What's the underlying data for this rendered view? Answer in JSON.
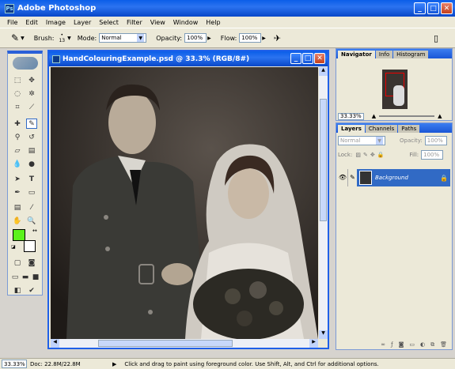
{
  "app": {
    "title": "Adobe Photoshop",
    "ps_label": "Ps"
  },
  "window_buttons": {
    "minimize": "_",
    "maximize": "□",
    "close": "✕"
  },
  "menu": [
    "File",
    "Edit",
    "Image",
    "Layer",
    "Select",
    "Filter",
    "View",
    "Window",
    "Help"
  ],
  "options": {
    "brush_label": "Brush:",
    "brush_size": "13",
    "mode_label": "Mode:",
    "mode_value": "Normal",
    "opacity_label": "Opacity:",
    "opacity_value": "100%",
    "flow_label": "Flow:",
    "flow_value": "100%"
  },
  "document": {
    "title": "HandColouringExample.psd @ 33.3% (RGB/8#)"
  },
  "navigator": {
    "tabs": [
      "Navigator",
      "Info",
      "Histogram"
    ],
    "zoom": "33.33%"
  },
  "layers": {
    "tabs": [
      "Layers",
      "Channels",
      "Paths"
    ],
    "blend_mode": "Normal",
    "opacity_label": "Opacity:",
    "opacity_value": "100%",
    "lock_label": "Lock:",
    "fill_label": "Fill:",
    "fill_value": "100%",
    "layer_name": "Background"
  },
  "status": {
    "zoom": "33.33%",
    "doc": "Doc: 22.8M/22.8M",
    "hint": "Click and drag to paint using foreground color.  Use Shift, Alt, and Ctrl for additional options."
  },
  "colors": {
    "foreground": "#5cf21c",
    "background": "#ffffff",
    "title_blue": "#0a5ee8"
  }
}
